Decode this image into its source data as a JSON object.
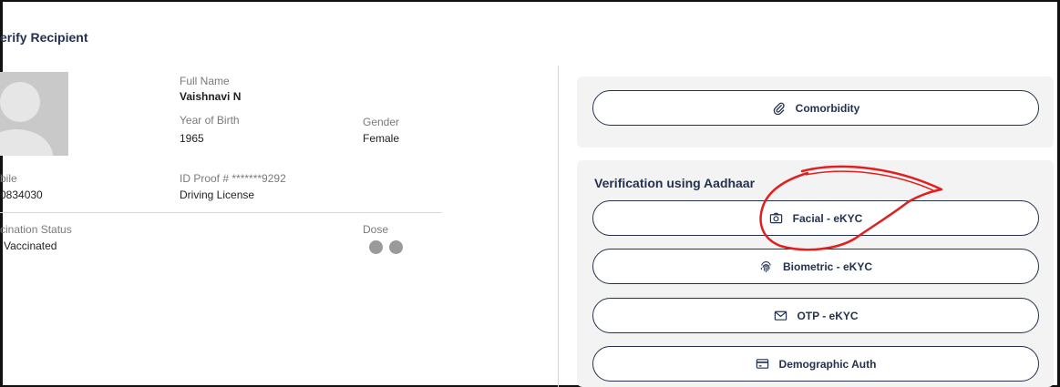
{
  "page": {
    "title": "erify Recipient"
  },
  "recipient": {
    "full_name_label": "Full Name",
    "full_name": "Vaishnavi N",
    "yob_label": "Year of Birth",
    "yob": "1965",
    "gender_label": "Gender",
    "gender": "Female",
    "mobile_label": "bile",
    "mobile": "0834030",
    "id_proof_label": "ID Proof # *******9292",
    "id_proof_type": "Driving License",
    "vaccination_status_label": "cination Status",
    "vaccination_status": "Vaccinated",
    "dose_label": "Dose",
    "doses_shown": 2
  },
  "comorbidity_button": {
    "label": "Comorbidity",
    "icon": "paperclip-icon"
  },
  "aadhaar": {
    "title": "Verification using Aadhaar",
    "options": [
      {
        "label": "Facial - eKYC",
        "icon": "camera-icon"
      },
      {
        "label": "Biometric - eKYC",
        "icon": "fingerprint-icon"
      },
      {
        "label": "OTP - eKYC",
        "icon": "envelope-icon"
      },
      {
        "label": "Demographic Auth",
        "icon": "card-icon"
      }
    ]
  },
  "colors": {
    "accent": "#23324f",
    "annotation": "#e02020",
    "panel_bg": "#f3f3f3"
  }
}
